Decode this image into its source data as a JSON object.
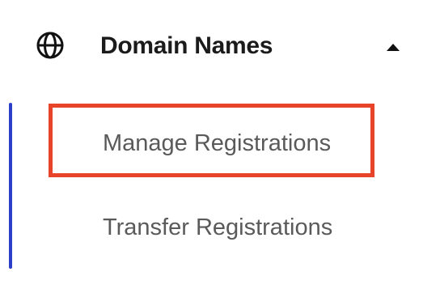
{
  "section": {
    "title": "Domain Names",
    "icon": "globe-icon",
    "toggle_icon": "caret-up-icon",
    "expanded": true
  },
  "subnav": {
    "items": [
      {
        "label": "Manage Registrations",
        "highlighted": true
      },
      {
        "label": "Transfer Registrations",
        "highlighted": false
      }
    ]
  },
  "colors": {
    "title": "#1b1b1b",
    "item_text": "#5a5a5a",
    "rail": "#2c3fc9",
    "highlight": "#e8442a"
  }
}
